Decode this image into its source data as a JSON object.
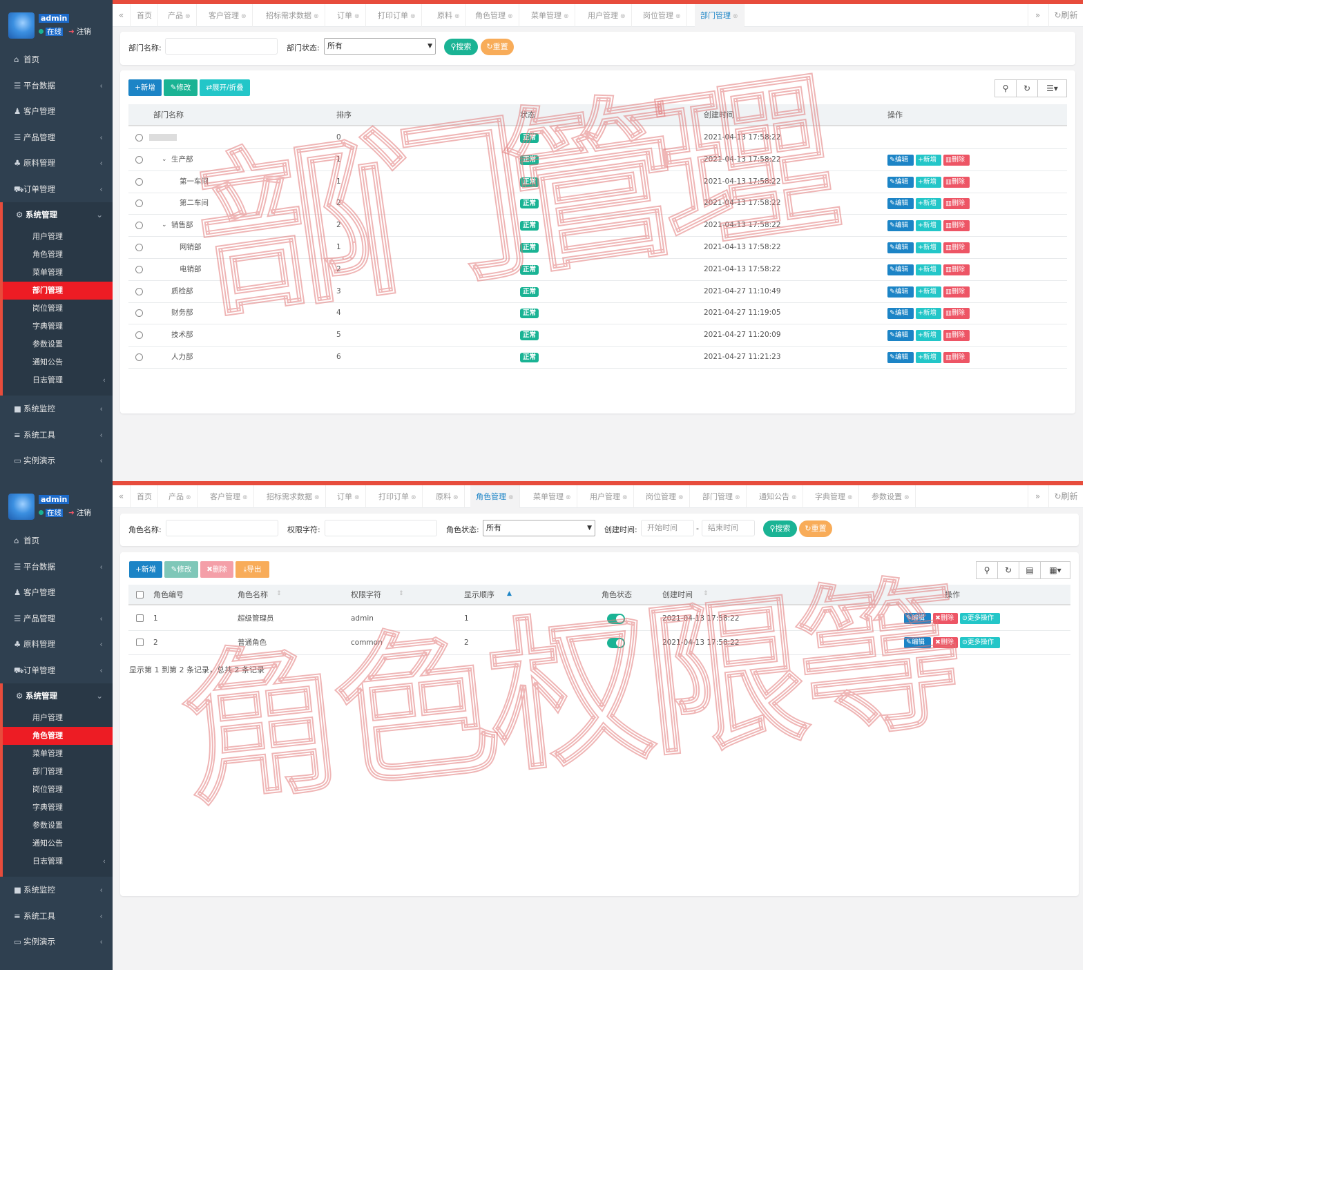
{
  "user": {
    "name": "admin",
    "online": "在线",
    "logout": "注销"
  },
  "menu_top": [
    {
      "label": "首页",
      "icon": "home-icon",
      "glyph": "⌂",
      "arrow": ""
    },
    {
      "label": "平台数据",
      "icon": "database-icon",
      "glyph": "☰",
      "arrow": "‹"
    },
    {
      "label": "客户管理",
      "icon": "users-icon",
      "glyph": "♟",
      "arrow": ""
    },
    {
      "label": "产品管理",
      "icon": "list-icon",
      "glyph": "☰",
      "arrow": "‹"
    },
    {
      "label": "原料管理",
      "icon": "sitemap-icon",
      "glyph": "♣",
      "arrow": "‹"
    },
    {
      "label": "订单管理",
      "icon": "cart-icon",
      "glyph": "⛟",
      "arrow": "‹"
    },
    {
      "label": "系统管理",
      "icon": "gear-icon",
      "glyph": "⚙",
      "arrow": "⌄"
    }
  ],
  "submenu": [
    "用户管理",
    "角色管理",
    "菜单管理",
    "部门管理",
    "岗位管理",
    "字典管理",
    "参数设置",
    "通知公告",
    "日志管理"
  ],
  "menu_bottom": [
    {
      "label": "系统监控",
      "icon": "video-icon",
      "glyph": "■",
      "arrow": "‹"
    },
    {
      "label": "系统工具",
      "icon": "bars-icon",
      "glyph": "≡",
      "arrow": "‹"
    },
    {
      "label": "实例演示",
      "icon": "desktop-icon",
      "glyph": "▭",
      "arrow": "‹"
    }
  ],
  "p1": {
    "tabs": [
      "首页",
      "产品",
      "客户管理",
      "招标需求数据",
      "订单",
      "打印订单",
      "原料",
      "角色管理",
      "菜单管理",
      "用户管理",
      "岗位管理",
      "部门管理"
    ],
    "active_tab": 11,
    "search": {
      "name_label": "部门名称:",
      "name_value": "",
      "status_label": "部门状态:",
      "status_value": "所有",
      "search_btn": "搜索",
      "reset_btn": "重置"
    },
    "toolbar": {
      "add": "新增",
      "edit": "修改",
      "expand": "展开/折叠"
    },
    "columns": [
      "部门名称",
      "排序",
      "状态",
      "创建时间",
      "操作"
    ],
    "rows": [
      {
        "name": "",
        "blur": true,
        "level": 0,
        "caret": false,
        "order": "0",
        "status": "正常",
        "created": "2021-04-13 17:58:22",
        "actions": false
      },
      {
        "name": "生产部",
        "level": 1,
        "caret": true,
        "order": "1",
        "status": "正常",
        "created": "2021-04-13 17:58:22",
        "actions": true
      },
      {
        "name": "第一车间",
        "level": 2,
        "caret": false,
        "order": "1",
        "status": "正常",
        "created": "2021-04-13 17:58:22",
        "actions": true
      },
      {
        "name": "第二车间",
        "level": 2,
        "caret": false,
        "order": "2",
        "status": "正常",
        "created": "2021-04-13 17:58:22",
        "actions": true
      },
      {
        "name": "销售部",
        "level": 1,
        "caret": true,
        "order": "2",
        "status": "正常",
        "created": "2021-04-13 17:58:22",
        "actions": true
      },
      {
        "name": "网销部",
        "level": 2,
        "caret": false,
        "order": "1",
        "status": "正常",
        "created": "2021-04-13 17:58:22",
        "actions": true
      },
      {
        "name": "电销部",
        "level": 2,
        "caret": false,
        "order": "2",
        "status": "正常",
        "created": "2021-04-13 17:58:22",
        "actions": true
      },
      {
        "name": "质检部",
        "level": 1,
        "caret": false,
        "order": "3",
        "status": "正常",
        "created": "2021-04-27 11:10:49",
        "actions": true
      },
      {
        "name": "财务部",
        "level": 1,
        "caret": false,
        "order": "4",
        "status": "正常",
        "created": "2021-04-27 11:19:05",
        "actions": true
      },
      {
        "name": "技术部",
        "level": 1,
        "caret": false,
        "order": "5",
        "status": "正常",
        "created": "2021-04-27 11:20:09",
        "actions": true
      },
      {
        "name": "人力部",
        "level": 1,
        "caret": false,
        "order": "6",
        "status": "正常",
        "created": "2021-04-27 11:21:23",
        "actions": true
      }
    ],
    "row_actions": {
      "edit": "编辑",
      "add": "新增",
      "delete": "删除"
    },
    "watermark": "部门管理"
  },
  "p2": {
    "tabs": [
      "首页",
      "产品",
      "客户管理",
      "招标需求数据",
      "订单",
      "打印订单",
      "原料",
      "角色管理",
      "菜单管理",
      "用户管理",
      "岗位管理",
      "部门管理",
      "通知公告",
      "字典管理",
      "参数设置"
    ],
    "active_tab": 7,
    "search": {
      "name_label": "角色名称:",
      "key_label": "权限字符:",
      "status_label": "角色状态:",
      "status_value": "所有",
      "time_label": "创建时间:",
      "start_placeholder": "开始时间",
      "end_placeholder": "结束时间",
      "dash": "-",
      "search_btn": "搜索",
      "reset_btn": "重置"
    },
    "toolbar": {
      "add": "新增",
      "edit": "修改",
      "delete": "删除",
      "export": "导出"
    },
    "columns": [
      "角色编号",
      "角色名称",
      "权限字符",
      "显示顺序",
      "角色状态",
      "创建时间",
      "操作"
    ],
    "rows": [
      {
        "id": "1",
        "name": "超级管理员",
        "key": "admin",
        "order": "1",
        "enabled": true,
        "created": "2021-04-13 17:58:22"
      },
      {
        "id": "2",
        "name": "普通角色",
        "key": "common",
        "order": "2",
        "enabled": true,
        "created": "2021-04-13 17:58:22"
      }
    ],
    "row_actions": {
      "edit": "编辑",
      "delete": "删除",
      "more": "更多操作"
    },
    "pagination": "显示第 1 到第 2 条记录，总共 2 条记录",
    "watermark": "角色权限等"
  },
  "common": {
    "refresh": "刷新"
  },
  "colors": {
    "sidebar": "#2f4050",
    "accent_red": "#ed1c24",
    "primary": "#1c84c6",
    "success": "#1ab394",
    "info": "#23c6c8",
    "danger": "#ed5565",
    "warning": "#f8ac59"
  }
}
